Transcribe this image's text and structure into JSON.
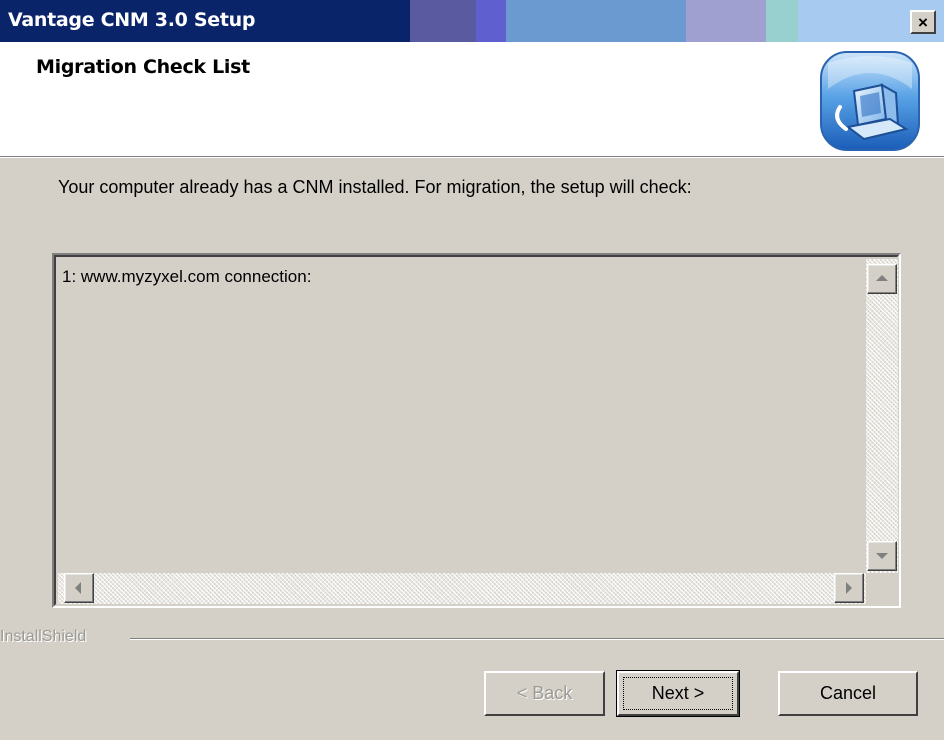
{
  "window": {
    "title": "Vantage CNM 3.0 Setup",
    "close_label": "×"
  },
  "header": {
    "title": "Migration Check List",
    "logo_icon": "installshield-computer-icon"
  },
  "main": {
    "instruction": "Your computer already has a CNM installed. For migration, the setup will check:",
    "list_items": [
      "1: www.myzyxel.com connection:"
    ]
  },
  "footer": {
    "brand": "InstallShield",
    "back_label": "< Back",
    "next_label": "Next >",
    "cancel_label": "Cancel"
  },
  "colors": {
    "titlebar_start": "#0a246a",
    "titlebar_end": "#a6caf0",
    "dialog_bg": "#d4d0c8",
    "disabled_text": "#9c9a94"
  }
}
